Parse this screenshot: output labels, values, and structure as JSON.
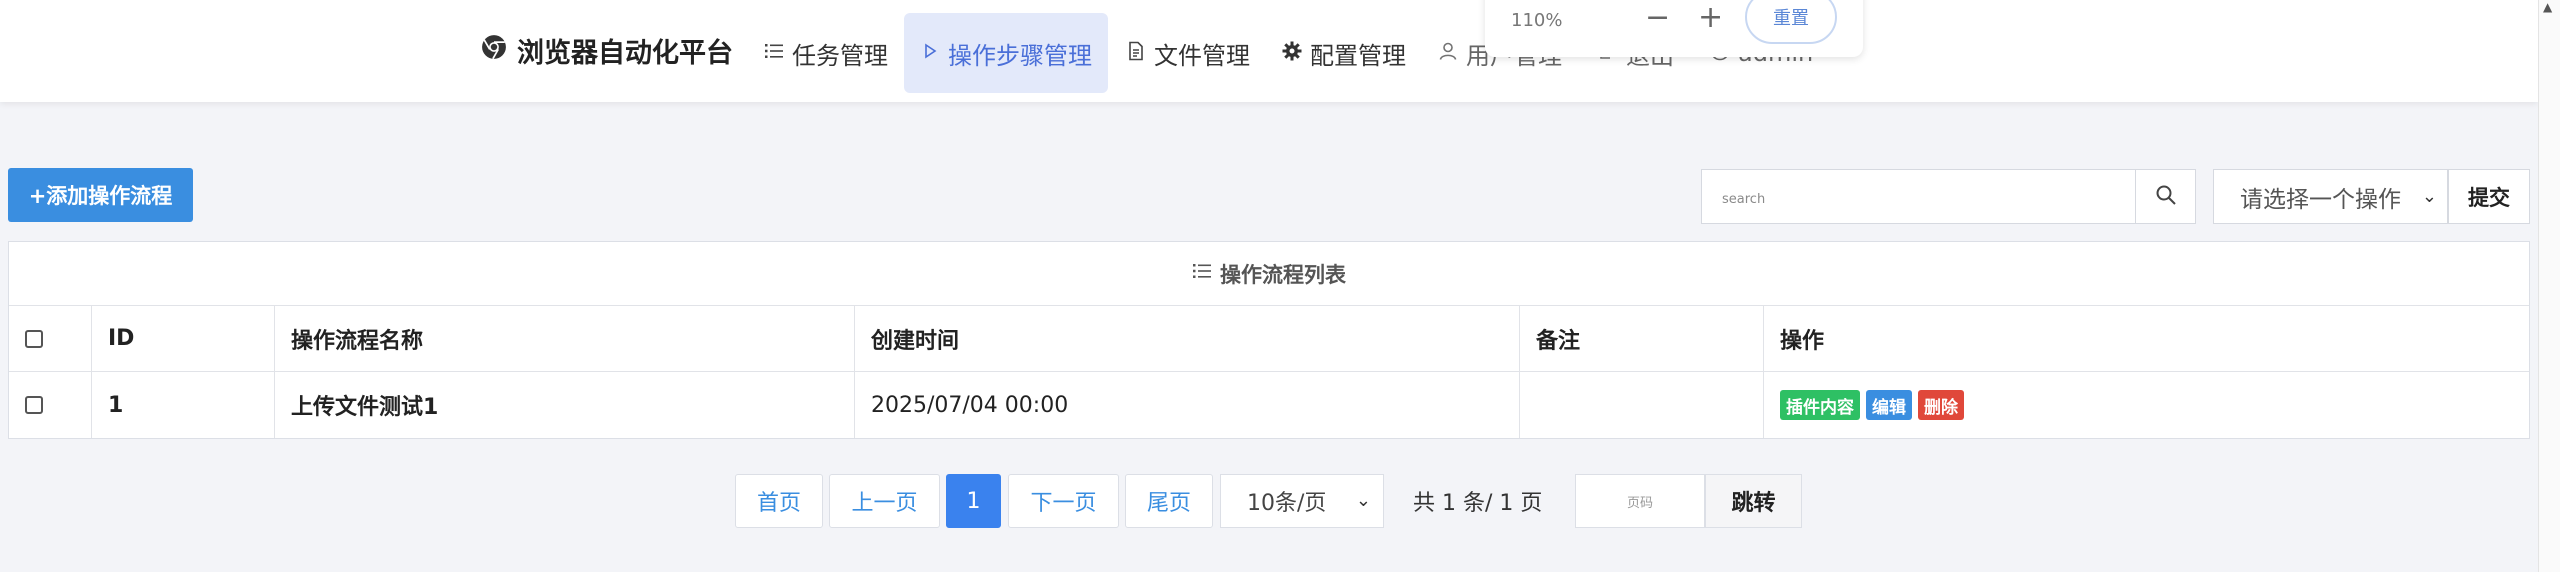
{
  "nav": {
    "brand": "浏览器自动化平台",
    "items": [
      {
        "label": "任务管理",
        "icon": "list-icon"
      },
      {
        "label": "操作步骤管理",
        "icon": "play-icon",
        "active": true
      },
      {
        "label": "文件管理",
        "icon": "file-icon"
      },
      {
        "label": "配置管理",
        "icon": "gear-icon"
      },
      {
        "label": "用户管理",
        "icon": "user-icon"
      },
      {
        "label": "退出",
        "icon": "logout-icon"
      }
    ],
    "user": "admin"
  },
  "zoom": {
    "level": "110%",
    "minus": "−",
    "plus": "+",
    "reset": "重置"
  },
  "toolbar": {
    "add_label": "+添加操作流程",
    "search_placeholder": "search",
    "select_value": "请选择一个操作",
    "submit_label": "提交"
  },
  "table": {
    "caption": "操作流程列表",
    "headers": [
      "",
      "ID",
      "操作流程名称",
      "创建时间",
      "备注",
      "操作"
    ],
    "rows": [
      {
        "id": "1",
        "name": "上传文件测试1",
        "created": "2025/07/04 00:00",
        "note": "",
        "actions": [
          "插件内容",
          "编辑",
          "删除"
        ]
      }
    ]
  },
  "pagination": {
    "first": "首页",
    "prev": "上一页",
    "current": "1",
    "next": "下一页",
    "last": "尾页",
    "page_size": "10条/页",
    "info": "共 1 条/ 1 页",
    "page_input_placeholder": "页码",
    "jump": "跳转"
  },
  "colors": {
    "primary": "#3a8ee0",
    "active_nav_bg": "#e3e9fa",
    "success": "#2ec064",
    "danger": "#e0483a"
  }
}
